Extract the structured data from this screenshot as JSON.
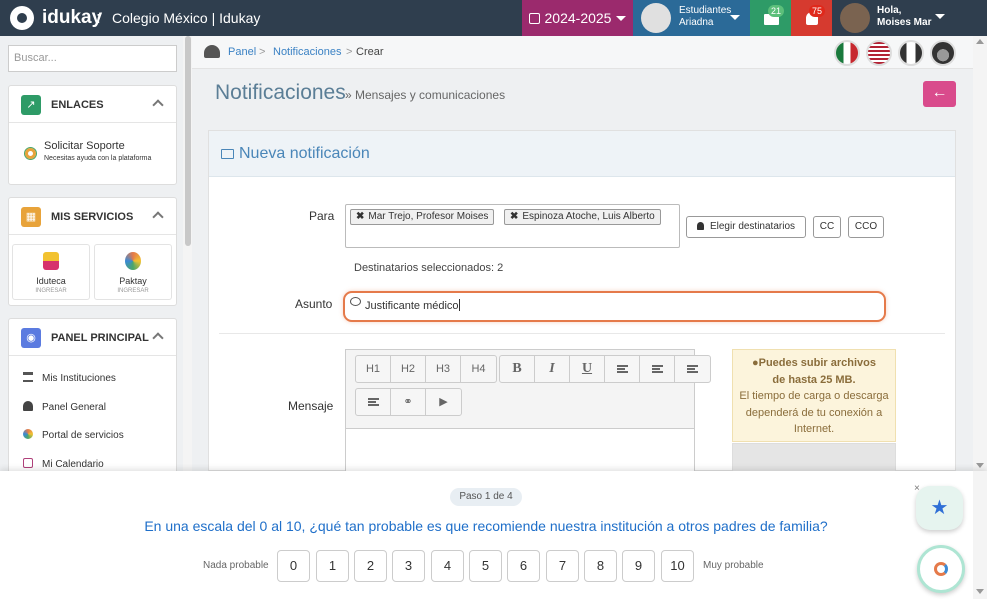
{
  "topbar": {
    "brand": "idukay",
    "separator": ":",
    "school": "Colegio México | Idukay",
    "year": "2024-2025",
    "students_line1": "Estudiantes",
    "students_line2": "Ariadna",
    "mail_count": "21",
    "notif_count": "75",
    "user_line1": "Hola,",
    "user_line2": "Moises Mar"
  },
  "sidebar": {
    "search_placeholder": "Buscar...",
    "links_title": "ENLACES",
    "support_title": "Solicitar Soporte",
    "support_sub": "Necesitas ayuda con la plataforma",
    "services_title": "MIS SERVICIOS",
    "services": [
      {
        "name": "Iduteca",
        "sub": "INGRESAR"
      },
      {
        "name": "Paktay",
        "sub": "INGRESAR"
      }
    ],
    "main_title": "PANEL PRINCIPAL",
    "menu": [
      "Mis Instituciones",
      "Panel General",
      "Portal de servicios",
      "Mi Calendario"
    ]
  },
  "breadcrumb": {
    "panel": "Panel",
    "notifications": "Notificaciones",
    "current": "Crear",
    "sep": ">"
  },
  "page": {
    "title": "Notificaciones",
    "subtitle": "» Mensajes y comunicaciones",
    "back_icon": "←"
  },
  "form": {
    "header": "Nueva notificación",
    "to_label": "Para",
    "recipients": [
      "Mar Trejo, Profesor Moises",
      "Espinoza Atoche, Luis Alberto"
    ],
    "chip_remove": "✖",
    "choose_btn": "Elegir destinatarios",
    "cc_btn": "CC",
    "cco_btn": "CCO",
    "selected_count": "Destinatarios seleccionados: 2",
    "subject_label": "Asunto",
    "subject_value": "Justificante médico",
    "message_label": "Mensaje",
    "toolbar": {
      "h1": "H1",
      "h2": "H2",
      "h3": "H3",
      "h4": "H4",
      "bold": "B",
      "italic": "I",
      "underline": "U"
    },
    "info_line1": "Puedes subir archivos",
    "info_line2": "de hasta 25 MB.",
    "info_rest": "El tiempo de carga o descarga dependerá de tu conexión a Internet."
  },
  "survey": {
    "step": "Paso 1 de 4",
    "question": "En una escala del 0 al 10, ¿qué tan probable es que recomiende nuestra institución a otros padres de familia?",
    "low_label": "Nada probable",
    "high_label": "Muy probable",
    "options": [
      "0",
      "1",
      "2",
      "3",
      "4",
      "5",
      "6",
      "7",
      "8",
      "9",
      "10"
    ],
    "close": "×"
  },
  "colors": {
    "topbar": "#2f3e4e",
    "year": "#9b2a6d",
    "students": "#2b6a98",
    "mail": "#2e9b67",
    "notifications": "#d63a2f",
    "accent_blue": "#1f6fc9",
    "back_button": "#d94b8c",
    "subject_focus": "#e57a4a"
  }
}
